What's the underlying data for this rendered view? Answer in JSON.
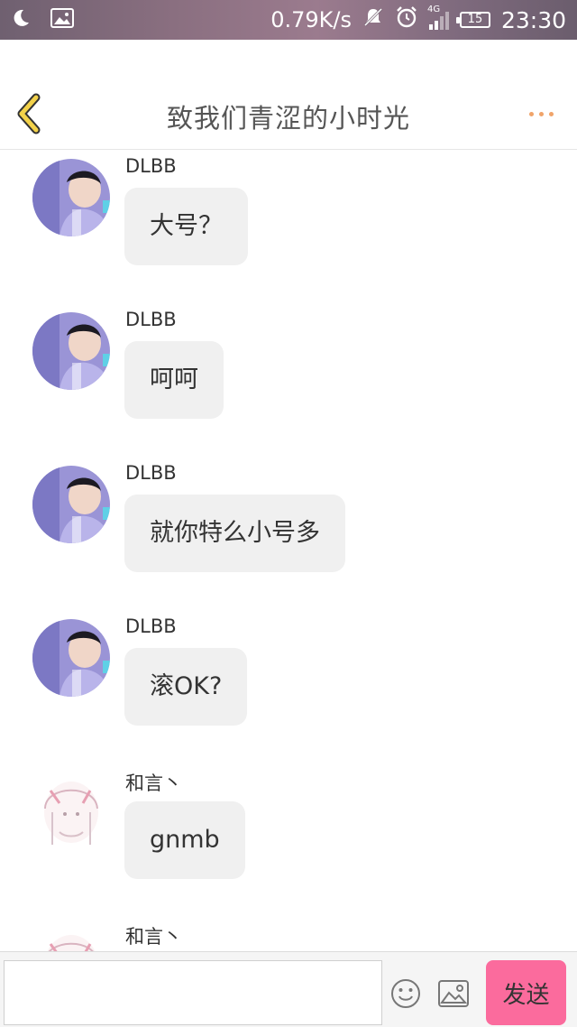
{
  "status_bar": {
    "icons_left": [
      "moon-icon",
      "image-icon"
    ],
    "net_speed": "0.79K/s",
    "icons_right": [
      "bell-off-icon",
      "alarm-icon",
      "signal-icon"
    ],
    "network_type": "4G",
    "battery": "15",
    "time": "23:30"
  },
  "header": {
    "title": "致我们青涩的小时光",
    "back_icon": "chevron-left-icon",
    "more_icon": "more-dots-icon",
    "accent_color": "#f0a46a"
  },
  "messages": [
    {
      "sender": "DLBB",
      "text": "大号？",
      "avatar": "photo-avatar"
    },
    {
      "sender": "DLBB",
      "text": "呵呵",
      "avatar": "photo-avatar"
    },
    {
      "sender": "DLBB",
      "text": "就你特么小号多",
      "avatar": "photo-avatar"
    },
    {
      "sender": "DLBB",
      "text": "滚OK?",
      "avatar": "photo-avatar"
    },
    {
      "sender": "和言丶",
      "text": "gnmb",
      "avatar": "sketch-avatar"
    },
    {
      "sender": "和言丶",
      "text": "",
      "avatar": "sketch-avatar"
    }
  ],
  "input_bar": {
    "value": "",
    "placeholder": "",
    "send_label": "发送",
    "send_color": "#fb6b9d",
    "emoji_icon": "smiley-icon",
    "image_icon": "image-icon"
  }
}
